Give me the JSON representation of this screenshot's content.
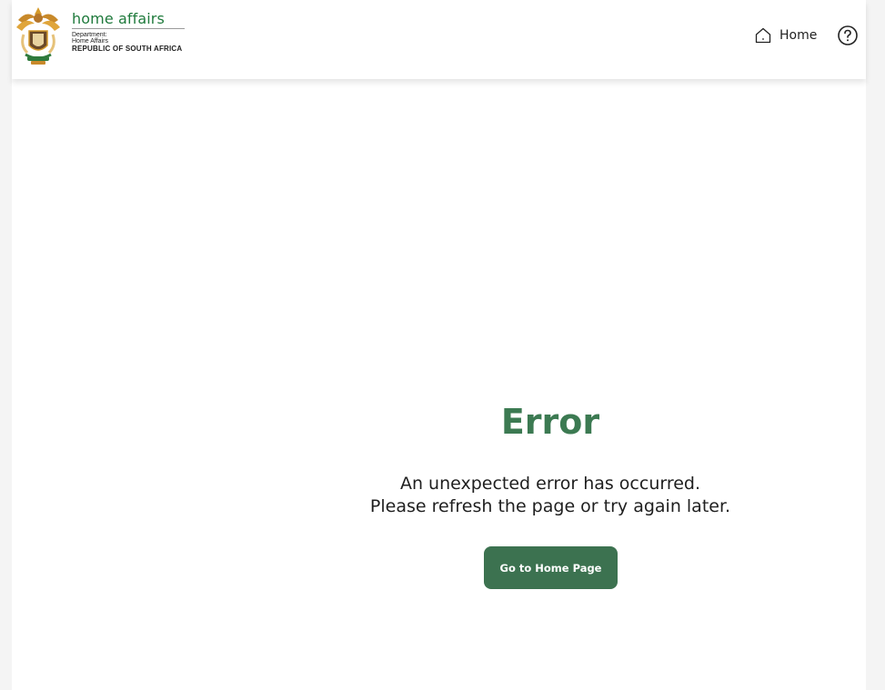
{
  "header": {
    "brand": {
      "name": "home affairs",
      "department_line1": "Department:",
      "department_line2": "Home Affairs",
      "republic": "REPUBLIC OF SOUTH AFRICA"
    },
    "nav": {
      "home_label": "Home",
      "home_icon": "home-icon",
      "help_icon": "help-icon"
    }
  },
  "error": {
    "title": "Error",
    "message_line1": "An unexpected error has occurred.",
    "message_line2": "Please refresh the page or try again later.",
    "button_label": "Go to Home Page"
  },
  "colors": {
    "brand_green": "#1f7a3c",
    "title_green": "#3c7a52",
    "button_green": "#3c7250",
    "page_bg": "#f4f4f4"
  }
}
